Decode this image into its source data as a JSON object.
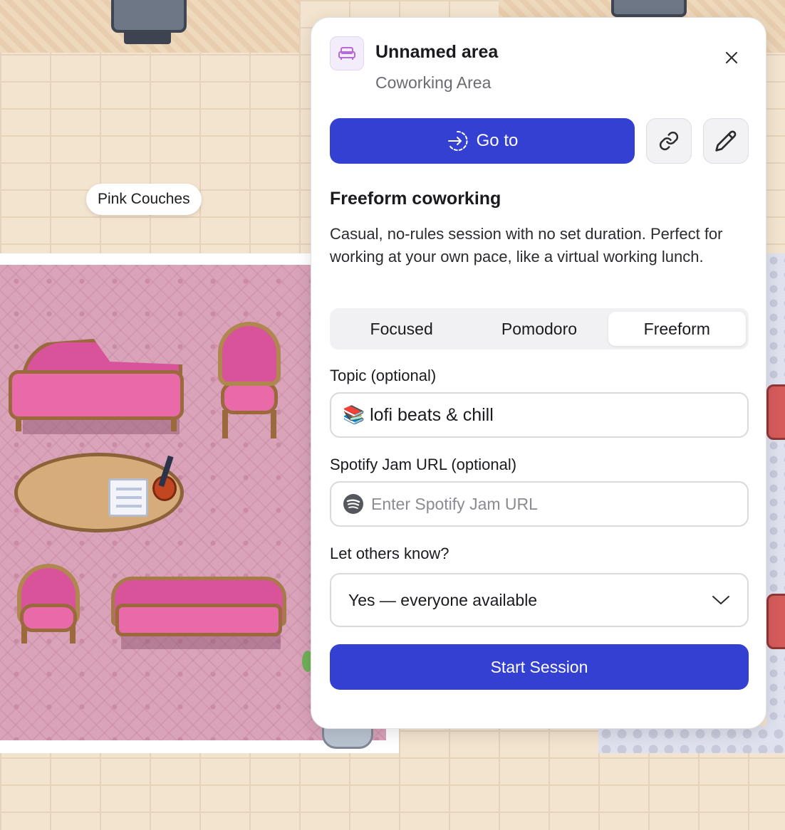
{
  "map": {
    "area_label": "Pink Couches"
  },
  "panel": {
    "area_icon": "sofa-icon",
    "title": "Unnamed area",
    "subtitle": "Coworking Area",
    "close_icon": "close-icon",
    "goto": {
      "icon": "enter-circle-icon",
      "label": "Go to"
    },
    "copy_link_icon": "link-icon",
    "edit_icon": "pencil-icon",
    "section": {
      "title": "Freeform coworking",
      "description": "Casual, no-rules session with no set duration. Perfect for working at your own pace, like a virtual working lunch."
    },
    "tabs": [
      {
        "label": "Focused",
        "active": false
      },
      {
        "label": "Pomodoro",
        "active": false
      },
      {
        "label": "Freeform",
        "active": true
      }
    ],
    "topic": {
      "label": "Topic (optional)",
      "value": "📚 lofi beats & chill"
    },
    "spotify": {
      "label": "Spotify Jam URL (optional)",
      "icon": "spotify-icon",
      "placeholder": "Enter Spotify Jam URL",
      "value": ""
    },
    "notify": {
      "label": "Let others know?",
      "selected": "Yes — everyone available"
    },
    "start_button": "Start Session"
  },
  "colors": {
    "primary": "#3340d1",
    "icon_tint": "#b46bd6",
    "carpet": "#d9a3b9",
    "floor": "#f3e4cf"
  }
}
